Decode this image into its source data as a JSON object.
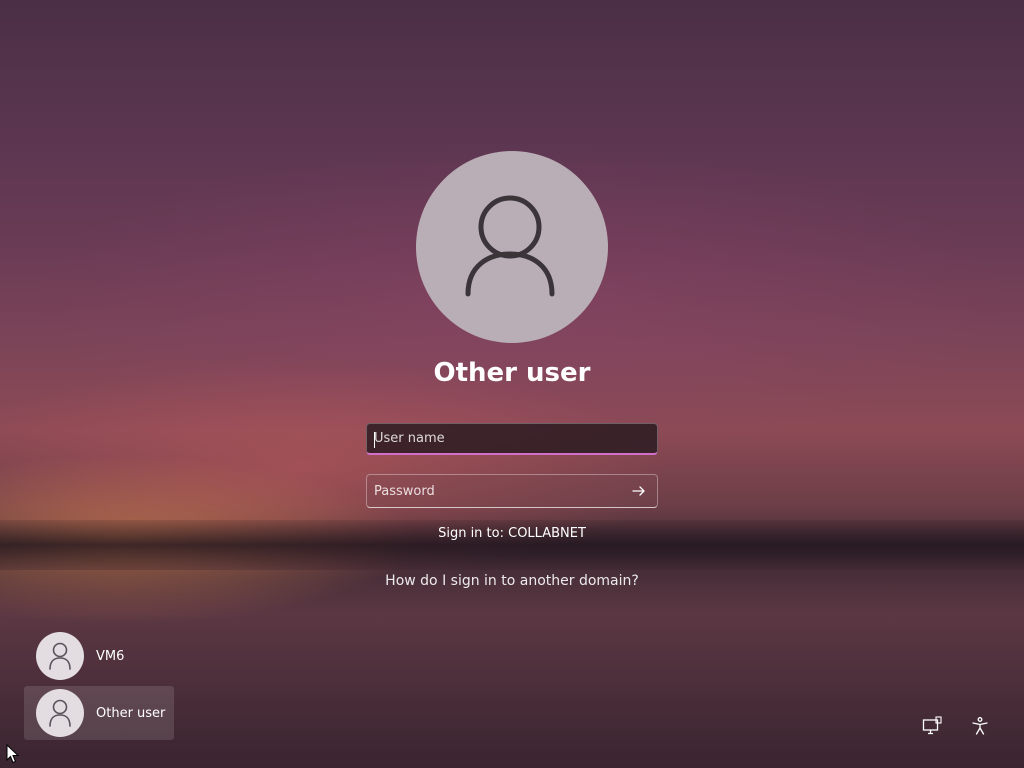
{
  "login": {
    "selected_user": "Other user",
    "username_placeholder": "User name",
    "password_placeholder": "Password",
    "sign_in_to": "Sign in to: COLLABNET",
    "domain_help_link": "How do I sign in to another domain?"
  },
  "user_tiles": [
    {
      "label": "VM6",
      "selected": false
    },
    {
      "label": "Other user",
      "selected": true
    }
  ],
  "icons": {
    "avatar": "person-icon",
    "submit": "arrow-right-icon",
    "network": "network-icon",
    "accessibility": "accessibility-icon"
  },
  "colors": {
    "focus_accent": "#d16fc9",
    "avatar_bg": "#b9adb6"
  }
}
